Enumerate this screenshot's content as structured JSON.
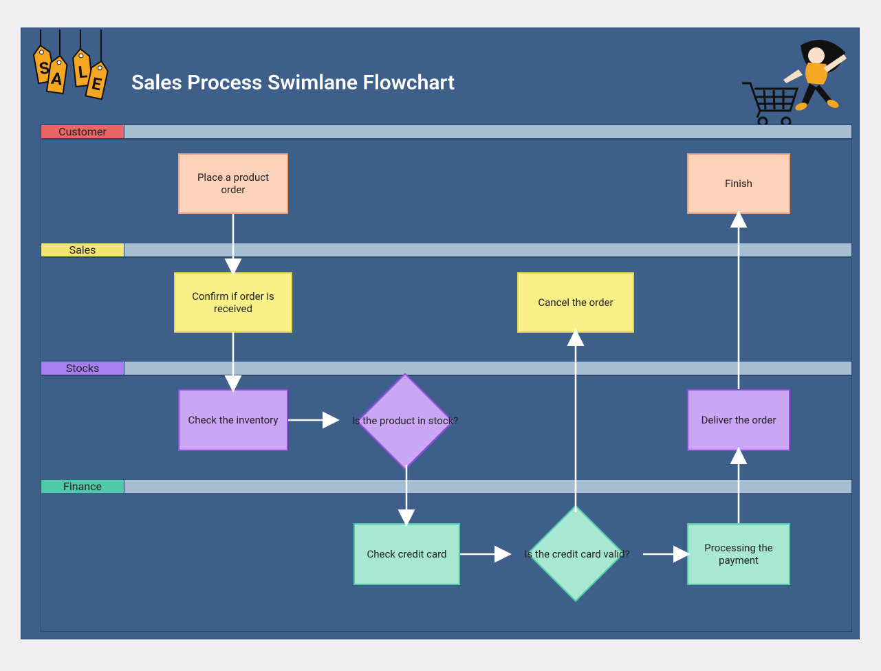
{
  "title": "Sales Process Swimlane Flowchart",
  "lanes": {
    "customer": "Customer",
    "sales": "Sales",
    "stocks": "Stocks",
    "finance": "Finance"
  },
  "nodes": {
    "place_order": "Place a product order",
    "finish": "Finish",
    "confirm_order": "Confirm if order is received",
    "cancel_order": "Cancel the order",
    "check_inventory": "Check the inventory",
    "product_in_stock": "Is the product in stock?",
    "deliver_order": "Deliver the order",
    "check_credit": "Check credit card",
    "credit_valid": "Is the credit card valid?",
    "process_payment": "Processing the payment"
  },
  "decor": {
    "sale_letters": [
      "S",
      "A",
      "L",
      "E"
    ]
  },
  "flow": [
    [
      "place_order",
      "confirm_order"
    ],
    [
      "confirm_order",
      "check_inventory"
    ],
    [
      "check_inventory",
      "product_in_stock"
    ],
    [
      "product_in_stock",
      "check_credit"
    ],
    [
      "check_credit",
      "credit_valid"
    ],
    [
      "credit_valid",
      "cancel_order"
    ],
    [
      "credit_valid",
      "process_payment"
    ],
    [
      "process_payment",
      "deliver_order"
    ],
    [
      "deliver_order",
      "finish"
    ]
  ]
}
